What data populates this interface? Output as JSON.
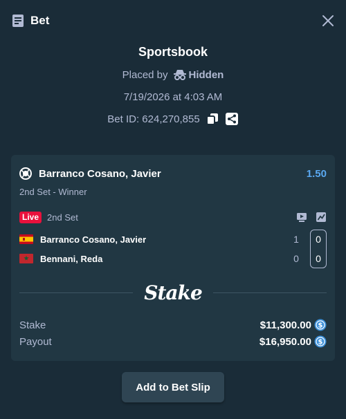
{
  "header": {
    "title": "Bet",
    "icon": "ticket-icon",
    "close_icon": "close-icon"
  },
  "info": {
    "sportsbook": "Sportsbook",
    "placed_by_label": "Placed by",
    "placed_by_name": "Hidden",
    "date": "7/19/2026 at 4:03 AM",
    "bet_id": "Bet ID: 624,270,855"
  },
  "bet": {
    "match": "Barranco Cosano, Javier",
    "odds": "1.50",
    "market": "2nd Set - Winner",
    "live_label": "Live",
    "set_label": "2nd Set",
    "players": [
      {
        "name": "Barranco Cosano, Javier",
        "sets": "1",
        "games": "0",
        "flag": "spain"
      },
      {
        "name": "Bennani, Reda",
        "sets": "0",
        "games": "0",
        "flag": "morocco"
      }
    ],
    "logo": "Stake",
    "stake_label": "Stake",
    "stake_value": "$11,300.00",
    "payout_label": "Payout",
    "payout_value": "$16,950.00"
  },
  "button": {
    "add_to_slip": "Add to Bet Slip"
  },
  "colors": {
    "bg": "#1a2c38",
    "card": "#213743",
    "odds": "#5aa8f0",
    "live": "#e9113c",
    "coin": "#3b8fd9"
  }
}
